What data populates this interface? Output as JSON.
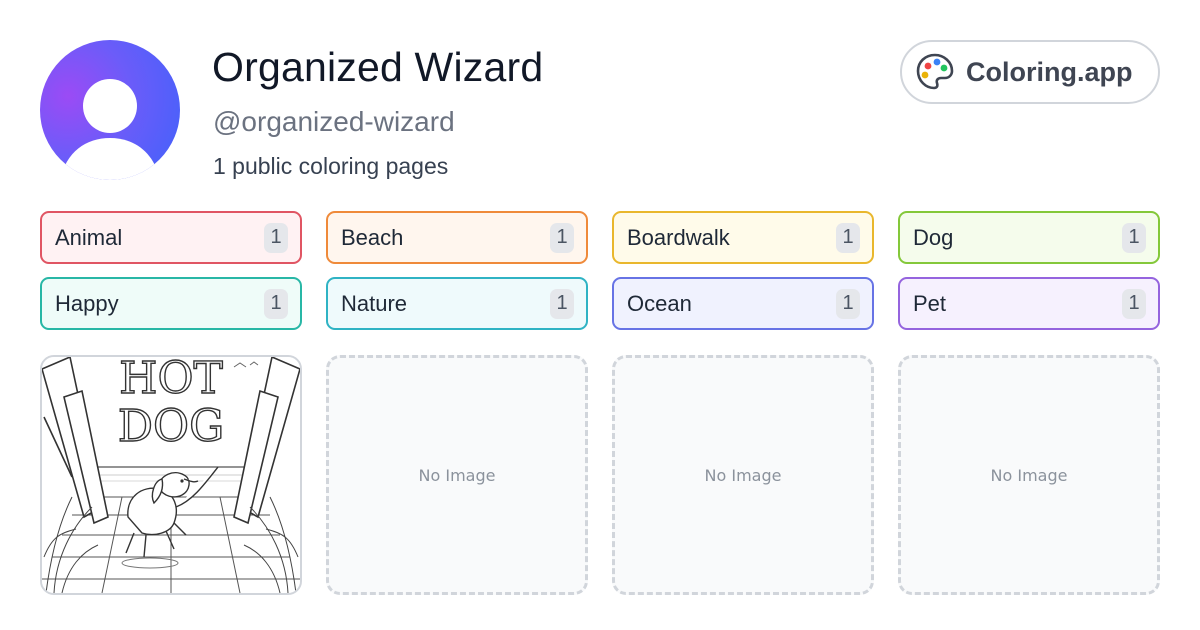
{
  "profile": {
    "name": "Organized Wizard",
    "handle": "@organized-wizard",
    "count_text": "1 public coloring pages"
  },
  "brand": {
    "label": "Coloring.app",
    "icon": "palette-icon"
  },
  "tags": [
    {
      "label": "Animal",
      "count": "1",
      "border": "#e05563",
      "bg": "#fff2f3"
    },
    {
      "label": "Beach",
      "count": "1",
      "border": "#ef8a3a",
      "bg": "#fff6ee"
    },
    {
      "label": "Boardwalk",
      "count": "1",
      "border": "#e9b72d",
      "bg": "#fffbea"
    },
    {
      "label": "Dog",
      "count": "1",
      "border": "#84c83a",
      "bg": "#f5fcec"
    },
    {
      "label": "Happy",
      "count": "1",
      "border": "#28b7a6",
      "bg": "#effcf9"
    },
    {
      "label": "Nature",
      "count": "1",
      "border": "#2fb3c4",
      "bg": "#effafc"
    },
    {
      "label": "Ocean",
      "count": "1",
      "border": "#6773e5",
      "bg": "#f0f2fe"
    },
    {
      "label": "Pet",
      "count": "1",
      "border": "#9564de",
      "bg": "#f6f1fe"
    }
  ],
  "pages": {
    "first": {
      "title_line1": "HOT",
      "title_line2": "DOG"
    },
    "empty_label": "No Image"
  },
  "colors": {
    "avatar_gradient": [
      "#9b4bf5",
      "#3f62fb"
    ],
    "palette_dots": [
      "#ef4444",
      "#3b82f6",
      "#22c55e",
      "#eab308"
    ]
  }
}
